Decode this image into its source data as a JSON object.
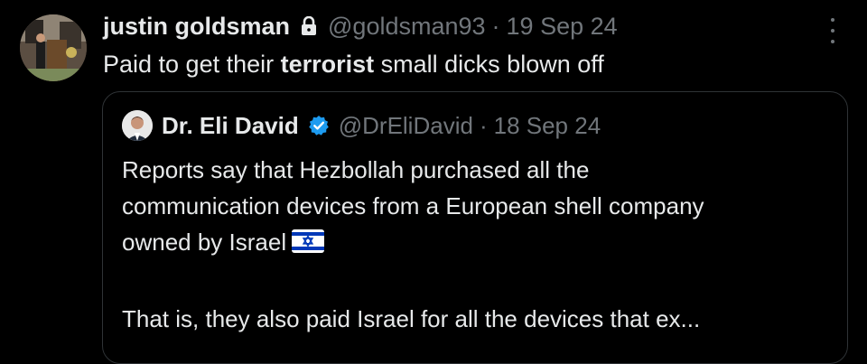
{
  "tweet": {
    "author_name": "justin goldsman",
    "handle": "@goldsman93",
    "separator": "·",
    "date": "19 Sep 24",
    "text_before": "Paid to get their ",
    "text_bold": "terrorist",
    "text_after": " small dicks blown off",
    "icons": {
      "lock": "lock-icon",
      "more": "more-options-icon",
      "avatar": "user-avatar"
    }
  },
  "quoted": {
    "author_name": "Dr. Eli David",
    "handle": "@DrEliDavid",
    "separator": "·",
    "date": "18 Sep 24",
    "lines": [
      "Reports say that Hezbollah purchased all the",
      "communication devices from a European shell company",
      "owned by Israel"
    ],
    "line_last": "That is, they also paid Israel for all the devices that ex...",
    "icons": {
      "verified": "verified-badge-icon",
      "flag": "israel-flag-emoji"
    }
  },
  "colors": {
    "background": "#000000",
    "text": "#e7e9ea",
    "muted": "#71767b",
    "verified": "#1d9bf0",
    "border": "#2f3336"
  }
}
